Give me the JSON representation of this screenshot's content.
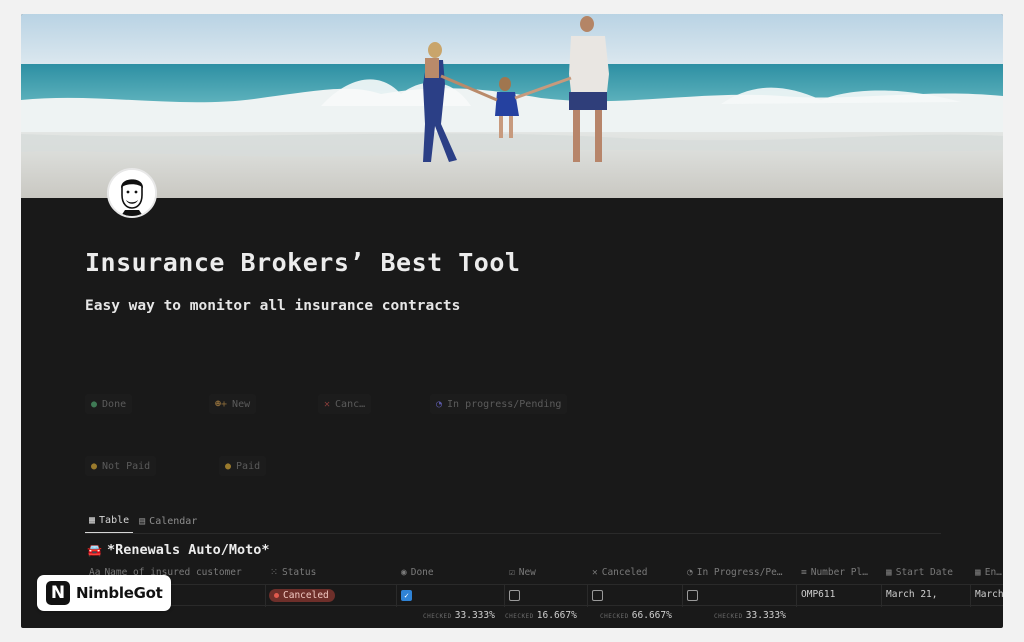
{
  "page": {
    "title": "Insurance Brokers’ Best Tool",
    "subtitle": "Easy way to monitor all insurance contracts"
  },
  "buttons": [
    {
      "icon": "check-circle-icon",
      "glyph": "✓",
      "label": "Done"
    },
    {
      "icon": "user-plus-icon",
      "glyph": "👥",
      "label": "New"
    },
    {
      "icon": "x-icon",
      "glyph": "✕",
      "label": "Canc…"
    },
    {
      "icon": "half-circle-icon",
      "glyph": "◔",
      "label": "In progress/Pending"
    },
    {
      "icon": "coin-icon",
      "glyph": "●",
      "label": "Not Paid"
    },
    {
      "icon": "coin-icon",
      "glyph": "●",
      "label": "Paid"
    }
  ],
  "tabs": [
    {
      "icon": "table-icon",
      "label": "Table",
      "active": true
    },
    {
      "icon": "calendar-icon",
      "label": "Calendar",
      "active": false
    }
  ],
  "database": {
    "icon": "car-icon",
    "title": "*Renewals Auto/Moto*"
  },
  "columns": [
    {
      "icon": "text-icon",
      "glyph": "Aa",
      "label": "Name of insured customer"
    },
    {
      "icon": "status-icon",
      "glyph": "⁙",
      "label": "Status"
    },
    {
      "icon": "check-circle-icon",
      "glyph": "✓",
      "label": "Done"
    },
    {
      "icon": "checkbox-icon",
      "glyph": "☑",
      "label": "New"
    },
    {
      "icon": "x-icon",
      "glyph": "✕",
      "label": "Canceled"
    },
    {
      "icon": "half-circle-icon",
      "glyph": "◔",
      "label": "In Progress/Pe…"
    },
    {
      "icon": "list-icon",
      "glyph": "≡",
      "label": "Number Pl…"
    },
    {
      "icon": "calendar-icon",
      "glyph": "▦",
      "label": "Start Date"
    },
    {
      "icon": "calendar-icon",
      "glyph": "▦",
      "label": "En…"
    }
  ],
  "row": {
    "name": "",
    "status": "Canceled",
    "done": true,
    "new": false,
    "canceled": false,
    "in_progress": false,
    "number_plate": "OMP611",
    "start_date": "March 21,",
    "end_date": "March"
  },
  "calculations": [
    {
      "label": "CHECKED",
      "value": "33.333%"
    },
    {
      "label": "CHECKED",
      "value": "16.667%"
    },
    {
      "label": "CHECKED",
      "value": "66.667%"
    },
    {
      "label": "CHECKED",
      "value": "33.333%"
    }
  ],
  "watermark": {
    "logo_letter": "N",
    "text": "NimbleGot"
  },
  "colors": {
    "background": "#191919",
    "accent_blue": "#2f83d6",
    "canceled_badge": "#6e2f2a",
    "car_red": "#d8494b"
  }
}
